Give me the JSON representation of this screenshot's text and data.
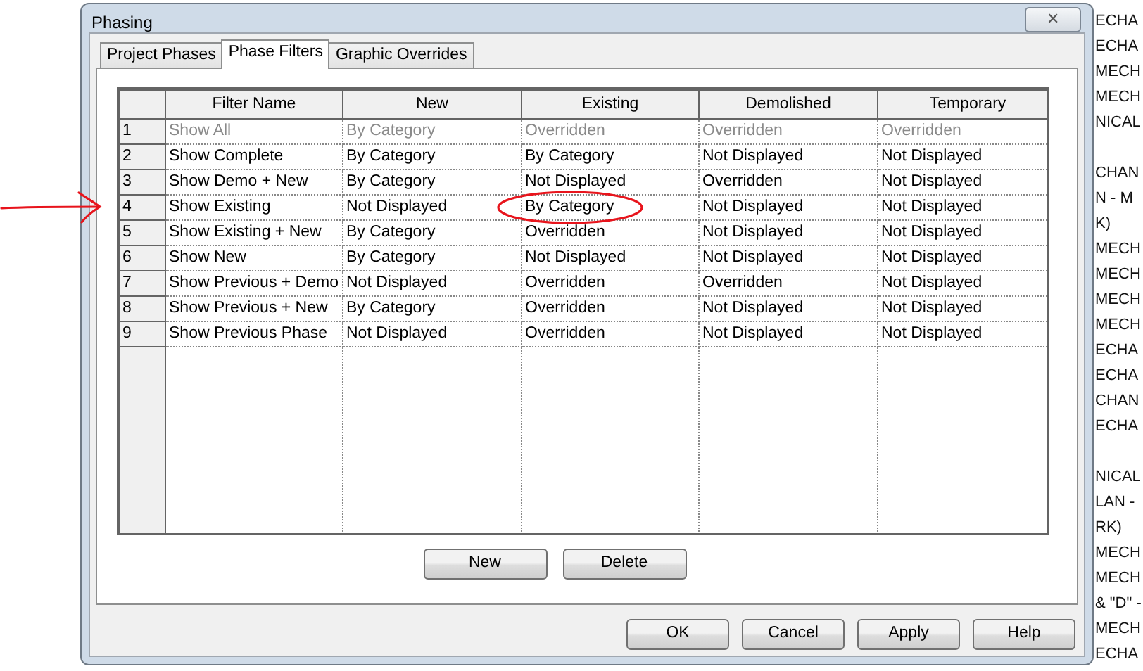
{
  "window": {
    "title": "Phasing",
    "close": "✕"
  },
  "tabs": [
    {
      "label": "Project Phases",
      "selected": false
    },
    {
      "label": "Phase Filters",
      "selected": true
    },
    {
      "label": "Graphic Overrides",
      "selected": false
    }
  ],
  "table": {
    "columns": [
      "Filter Name",
      "New",
      "Existing",
      "Demolished",
      "Temporary"
    ],
    "rows": [
      {
        "number": "1",
        "disabled": true,
        "cells": [
          "Show All",
          "By Category",
          "Overridden",
          "Overridden",
          "Overridden"
        ]
      },
      {
        "number": "2",
        "disabled": false,
        "cells": [
          "Show Complete",
          "By Category",
          "By Category",
          "Not Displayed",
          "Not Displayed"
        ]
      },
      {
        "number": "3",
        "disabled": false,
        "cells": [
          "Show Demo + New",
          "By Category",
          "Not Displayed",
          "Overridden",
          "Not Displayed"
        ]
      },
      {
        "number": "4",
        "disabled": false,
        "cells": [
          "Show Existing",
          "Not Displayed",
          "By Category",
          "Not Displayed",
          "Not Displayed"
        ]
      },
      {
        "number": "5",
        "disabled": false,
        "cells": [
          "Show Existing + New",
          "By Category",
          "Overridden",
          "Not Displayed",
          "Not Displayed"
        ]
      },
      {
        "number": "6",
        "disabled": false,
        "cells": [
          "Show New",
          "By Category",
          "Not Displayed",
          "Not Displayed",
          "Not Displayed"
        ]
      },
      {
        "number": "7",
        "disabled": false,
        "cells": [
          "Show Previous + Demo",
          "Not Displayed",
          "Overridden",
          "Overridden",
          "Not Displayed"
        ]
      },
      {
        "number": "8",
        "disabled": false,
        "cells": [
          "Show Previous + New",
          "By Category",
          "Overridden",
          "Not Displayed",
          "Not Displayed"
        ]
      },
      {
        "number": "9",
        "disabled": false,
        "cells": [
          "Show Previous Phase",
          "Not Displayed",
          "Overridden",
          "Not Displayed",
          "Not Displayed"
        ]
      }
    ]
  },
  "table_buttons": [
    "New",
    "Delete"
  ],
  "dialog_buttons": [
    "OK",
    "Cancel",
    "Apply",
    "Help"
  ],
  "background_groups": [
    {
      "lines": [
        "ECHA",
        "ECHA",
        "MECH",
        "MECH",
        "NICAL"
      ]
    },
    {
      "lines": [
        "CHAN",
        "N - M",
        "K)",
        "MECH",
        "MECH",
        "MECH",
        "MECH",
        "ECHA",
        "ECHA",
        "CHAN",
        "ECHA"
      ]
    },
    {
      "lines": [
        "NICAL",
        "LAN -",
        "RK)",
        "MECH",
        "MECH",
        "& \"D\" -",
        "MECH",
        "ECHA"
      ]
    }
  ]
}
